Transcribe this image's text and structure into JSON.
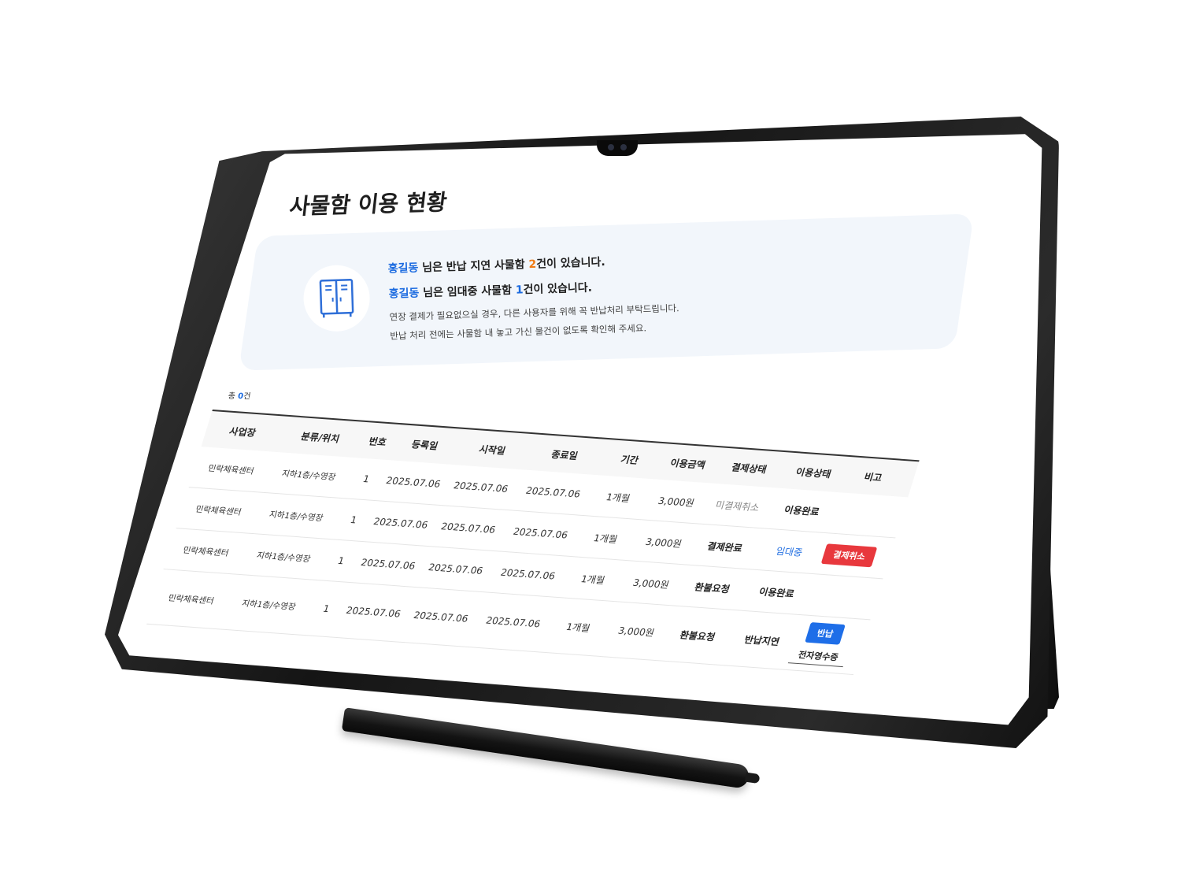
{
  "page": {
    "title": "사물함 이용 현황"
  },
  "notice": {
    "user_name": "홍길동",
    "overdue_prefix": " 님은 반납 지연 사물함 ",
    "overdue_count": "2",
    "overdue_suffix": "건이 있습니다.",
    "renting_prefix": " 님은 임대중 사물함 ",
    "renting_count": "1",
    "renting_suffix": "건이 있습니다.",
    "sub1": "연장 결제가 필요없으실 경우, 다른 사용자를 위해 꼭 반납처리 부탁드립니다.",
    "sub2": "반납 처리 전에는 사물함 내 놓고 가신 물건이 없도록 확인해 주세요.",
    "icon": "locker-icon"
  },
  "list": {
    "total_prefix": "총 ",
    "total_count": "0",
    "total_suffix": "건"
  },
  "table": {
    "headers": [
      "사업장",
      "분류/위치",
      "번호",
      "등록일",
      "시작일",
      "종료일",
      "기간",
      "이용금액",
      "결제상태",
      "이용상태",
      "비고"
    ],
    "rows": [
      {
        "place": "민락체육센터",
        "location": "지하1층/수영장",
        "number": "1",
        "registered": "2025.07.06",
        "start": "2025.07.06",
        "end": "2025.07.06",
        "period": "1개월",
        "amount": "3,000원",
        "payment": "미결제취소",
        "usage": "이용완료",
        "note": ""
      },
      {
        "place": "민락체육센터",
        "location": "지하1층/수영장",
        "number": "1",
        "registered": "2025.07.06",
        "start": "2025.07.06",
        "end": "2025.07.06",
        "period": "1개월",
        "amount": "3,000원",
        "payment": "결제완료",
        "usage": "임대중",
        "note": "결제취소"
      },
      {
        "place": "민락체육센터",
        "location": "지하1층/수영장",
        "number": "1",
        "registered": "2025.07.06",
        "start": "2025.07.06",
        "end": "2025.07.06",
        "period": "1개월",
        "amount": "3,000원",
        "payment": "환불요청",
        "usage": "이용완료",
        "note": ""
      },
      {
        "place": "민락체육센터",
        "location": "지하1층/수영장",
        "number": "1",
        "registered": "2025.07.06",
        "start": "2025.07.06",
        "end": "2025.07.06",
        "period": "1개월",
        "amount": "3,000원",
        "payment": "환불요청",
        "usage": "반납지연",
        "note": "반납",
        "note2": "전자영수증"
      }
    ]
  },
  "colors": {
    "accent_blue": "#1c6be0",
    "overdue_orange": "#f07b14",
    "cancel_red": "#e8383d",
    "return_blue": "#1e6ee8"
  }
}
